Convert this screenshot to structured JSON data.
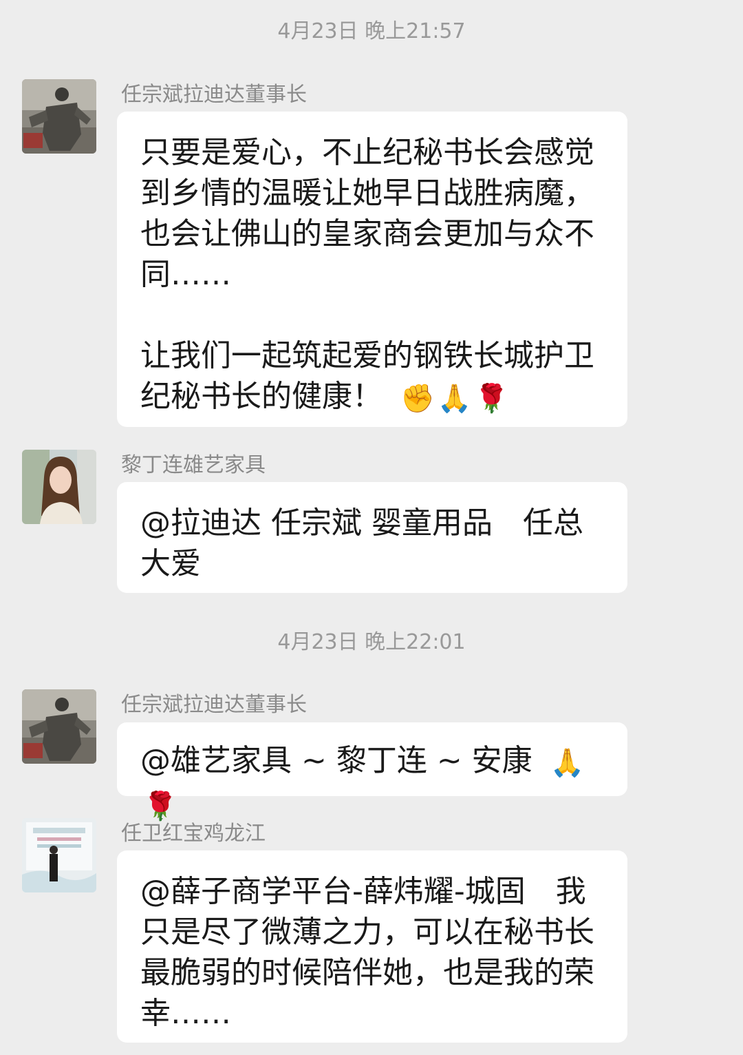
{
  "messages": {
    "t1": "4月23日 晚上21:57",
    "t2": "4月23日 晚上22:01",
    "m1": {
      "sender": "任宗斌拉迪达董事长",
      "para1": "只要是爱心，不止纪秘书长会感觉到乡情的温暖让她早日战胜病魔，也会让佛山的皇家商会更加与众不同……",
      "para2": "让我们一起筑起爱的钢铁长城护卫纪秘书长的健康！",
      "emoji1": "✊",
      "emoji2": "🙏",
      "emoji3": "🌹"
    },
    "m2": {
      "sender": "黎丁连雄艺家具",
      "text": "@拉迪达 任宗斌 婴童用品　任总大爱"
    },
    "m3": {
      "sender": "任宗斌拉迪达董事长",
      "text": "@雄艺家具 ~ 黎丁连 ~ 安康",
      "emoji1": "🙏",
      "emoji2": "🌹"
    },
    "m4": {
      "sender": "任卫红宝鸡龙江",
      "text": "@薛子商学平台-薛炜耀-城固　我只是尽了微薄之力，可以在秘书长最脆弱的时候陪伴她，也是我的荣幸……"
    }
  },
  "icons": {
    "avatar1": "statue-photo-avatar",
    "avatar2": "woman-portrait-avatar",
    "avatar3": "statue-photo-avatar",
    "avatar4": "event-backdrop-avatar"
  },
  "colors": {
    "background": "#ededed",
    "bubble": "#ffffff",
    "timestamp": "#999999",
    "sender": "#8a8a8a",
    "text": "#1a1a1a"
  }
}
